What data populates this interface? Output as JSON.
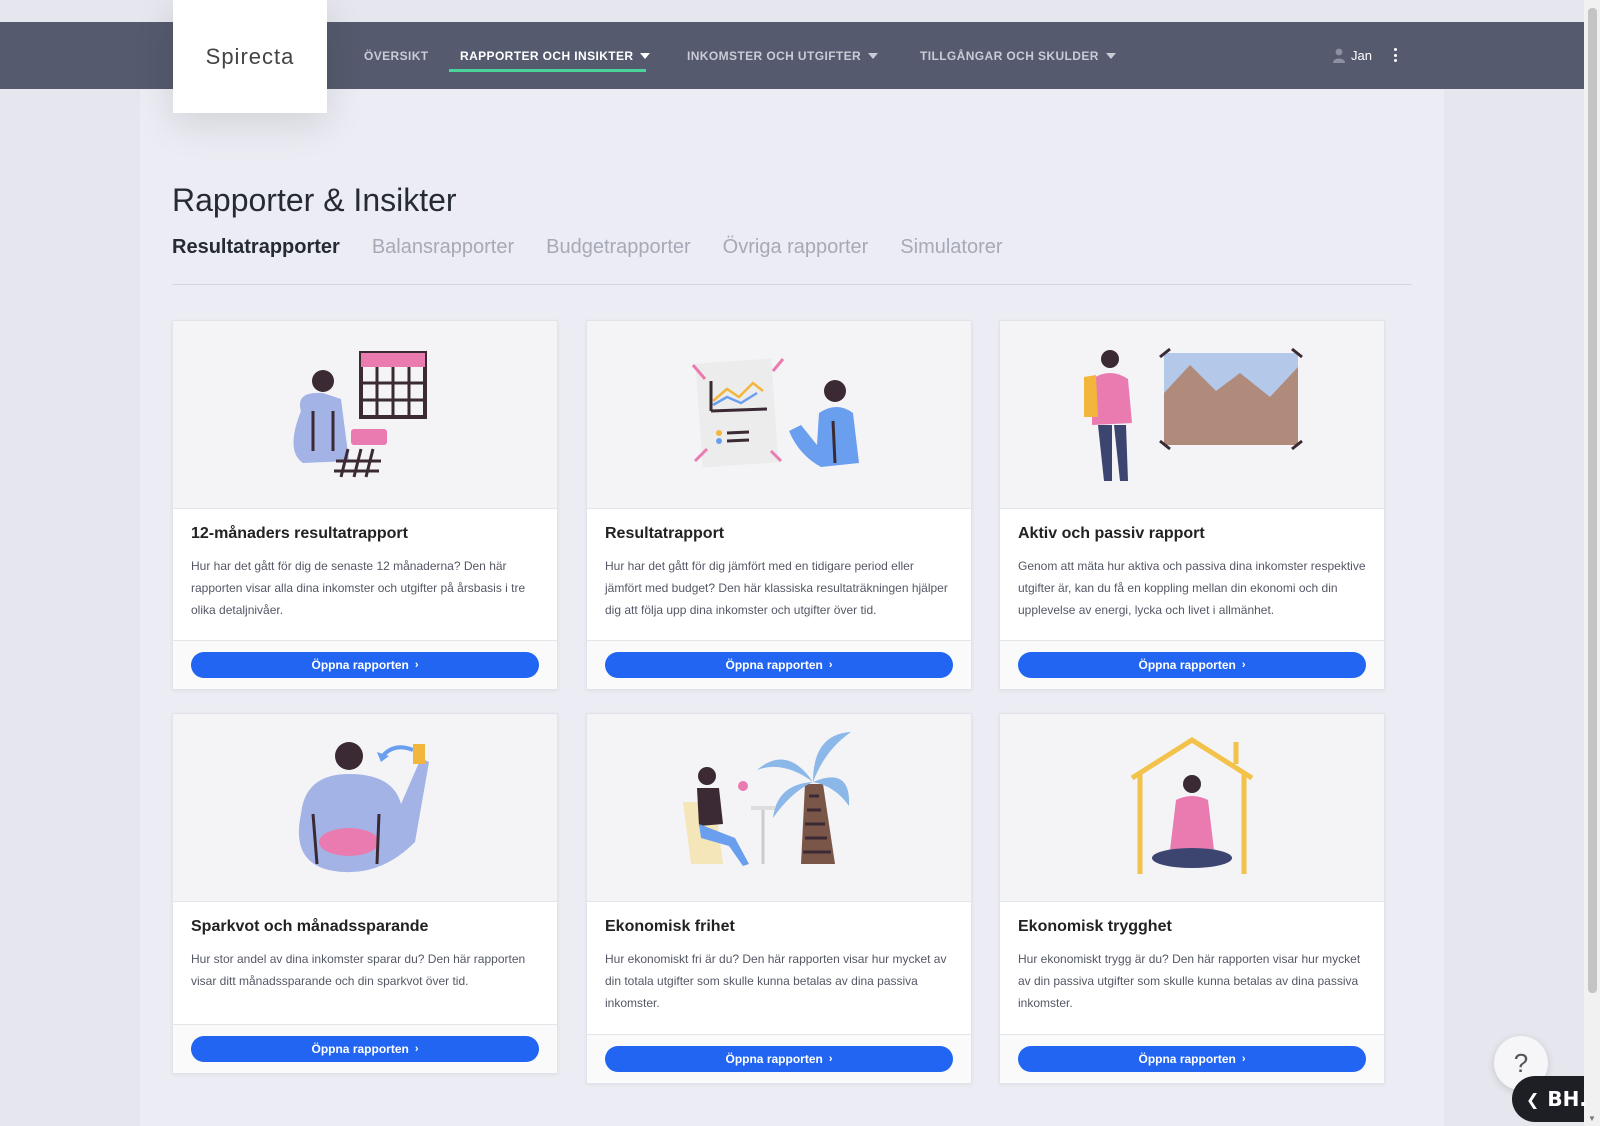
{
  "app": {
    "logo": "Spirecta"
  },
  "nav": {
    "items": [
      {
        "label": "ÖVERSIKT"
      },
      {
        "label": "RAPPORTER OCH INSIKTER"
      },
      {
        "label": "INKOMSTER OCH UTGIFTER"
      },
      {
        "label": "TILLGÅNGAR OCH SKULDER"
      }
    ],
    "user": "Jan"
  },
  "page": {
    "title": "Rapporter & Insikter",
    "tabs": [
      {
        "label": "Resultatrapporter"
      },
      {
        "label": "Balansrapporter"
      },
      {
        "label": "Budgetrapporter"
      },
      {
        "label": "Övriga rapporter"
      },
      {
        "label": "Simulatorer"
      }
    ]
  },
  "cards": [
    {
      "title": "12-månaders resultatrapport",
      "text": "Hur har det gått för dig de senaste 12 månaderna? Den här rapporten visar alla dina inkomster och utgifter på årsbasis i tre olika detaljnivåer.",
      "button": "Öppna rapporten"
    },
    {
      "title": "Resultatrapport",
      "text": "Hur har det gått för dig jämfört med en tidigare period eller jämfört med budget? Den här klassiska resultaträkningen hjälper dig att följa upp dina inkomster och utgifter över tid.",
      "button": "Öppna rapporten"
    },
    {
      "title": "Aktiv och passiv rapport",
      "text": "Genom att mäta hur aktiva och passiva dina inkomster respektive utgifter är, kan du få en koppling mellan din ekonomi och din upplevelse av energi, lycka och livet i allmänhet.",
      "button": "Öppna rapporten"
    },
    {
      "title": "Sparkvot och månadssparande",
      "text": "Hur stor andel av dina inkomster sparar du? Den här rapporten visar ditt månadssparande och din sparkvot över tid.",
      "button": "Öppna rapporten"
    },
    {
      "title": "Ekonomisk frihet",
      "text": "Hur ekonomiskt fri är du? Den här rapporten visar hur mycket av din totala utgifter som skulle kunna betalas av dina passiva inkomster.",
      "button": "Öppna rapporten"
    },
    {
      "title": "Ekonomisk trygghet",
      "text": "Hur ekonomiskt trygg är du? Den här rapporten visar hur mycket av din passiva utgifter som skulle kunna betalas av dina passiva inkomster.",
      "button": "Öppna rapporten"
    }
  ],
  "widgets": {
    "help": "?",
    "bh": "BH."
  },
  "colors": {
    "accent": "#2165f2",
    "nav_bg": "#555a6e",
    "nav_underline": "#4ad39b"
  }
}
